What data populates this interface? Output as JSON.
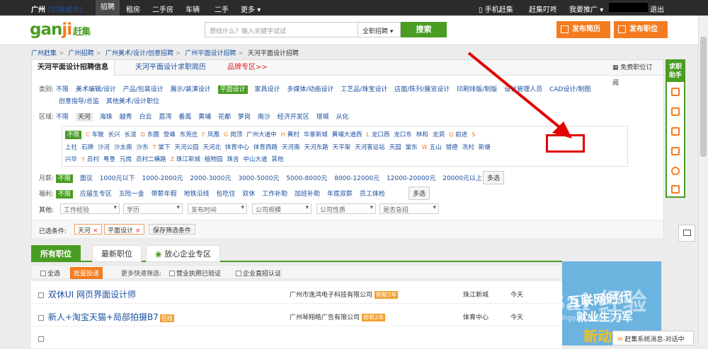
{
  "topbar": {
    "city": "广州",
    "switch_city": "[切换城市]",
    "nav": [
      "招聘",
      "租房",
      "二手房",
      "车辆",
      "二手",
      "更多"
    ],
    "mobile": "手机赶集",
    "chat": "赶集叮咚",
    "promote": "我要推广",
    "logout": "退出"
  },
  "header": {
    "logo_main": "gan",
    "logo_o": "ji",
    "logo_zj": "赶集",
    "search_placeholder": "想找什么？输入关键字试试",
    "search_scope": "全职招聘",
    "search_button": "搜索",
    "post_resume": "发布简历",
    "post_job": "发布职位"
  },
  "breadcrumb": [
    "广州赶集",
    "广州招聘",
    "广州美术/设计/创意招聘",
    "广州平面设计招聘",
    "天河平面设计招聘"
  ],
  "panel": {
    "tabs": [
      "天河平面设计招聘信息",
      "天河平面设计求职简历",
      "品牌专区>>"
    ],
    "subscribe": "免费职位订阅",
    "category_label": "类别:",
    "categories_row1": [
      "不限",
      "美术编辑/设计",
      "产品/包装设计",
      "展示/装潢设计",
      "平面设计",
      "家具设计",
      "多媒体/动画设计",
      "工艺品/珠宝设计",
      "店面/陈列/展览设计",
      "印刷排版/制版",
      "设计管理人员",
      "CAD设计/制图"
    ],
    "categories_row2": [
      "创意指导/总监",
      "其他美术/设计职位"
    ],
    "region_label": "区域:",
    "regions": [
      "不限",
      "天河",
      "海珠",
      "越秀",
      "白云",
      "荔湾",
      "番禺",
      "黄埔",
      "花都",
      "萝岗",
      "南沙",
      "经济开发区",
      "增城",
      "从化"
    ],
    "salary_label": "月薪:",
    "salaries": [
      "不限",
      "面议",
      "1000元以下",
      "1000-2000元",
      "2000-3000元",
      "3000-5000元",
      "5000-8000元",
      "8000-12000元",
      "12000-20000元",
      "20000元以上"
    ],
    "multi": "多选",
    "welfare_label": "福利:",
    "welfare": [
      "不限",
      "应届生专区",
      "五险一金",
      "带薪年假",
      "地铁沿线",
      "包吃住",
      "双休",
      "工作补助",
      "加班补助",
      "年底双薪",
      "员工体检"
    ],
    "other_label": "其他:",
    "dropdowns": [
      "工作经验",
      "学历",
      "发布时间",
      "公司规模",
      "公司性质",
      "是否急招"
    ],
    "selected_label": "已选条件:",
    "selected": [
      "天河",
      "平面设计"
    ],
    "save_filter": "保存筛选条件"
  },
  "districts": {
    "row1": [
      {
        "letter": "",
        "name": "不限"
      },
      {
        "letter": "C",
        "name": "车陂"
      },
      {
        "letter": "",
        "name": "长兴"
      },
      {
        "letter": "",
        "name": "长湴"
      },
      {
        "letter": "D",
        "name": "东圃"
      },
      {
        "letter": "",
        "name": "登峰"
      },
      {
        "letter": "",
        "name": "东莞庄"
      },
      {
        "letter": "F",
        "name": "凤凰"
      },
      {
        "letter": "G",
        "name": "岗顶"
      },
      {
        "letter": "",
        "name": "广州大道中"
      },
      {
        "letter": "H",
        "name": "黄村"
      },
      {
        "letter": "",
        "name": "华景新城"
      },
      {
        "letter": "",
        "name": "黄埔大道西"
      },
      {
        "letter": "L",
        "name": "龙口西"
      },
      {
        "letter": "",
        "name": "龙口东"
      },
      {
        "letter": "",
        "name": "林和"
      },
      {
        "letter": "",
        "name": "龙洞"
      },
      {
        "letter": "Q",
        "name": "前进"
      },
      {
        "letter": "S",
        "name": ""
      }
    ],
    "row2": [
      {
        "letter": "",
        "name": "上社"
      },
      {
        "letter": "",
        "name": "石牌"
      },
      {
        "letter": "",
        "name": "沙河"
      },
      {
        "letter": "",
        "name": "沙太南"
      },
      {
        "letter": "",
        "name": "沙东"
      },
      {
        "letter": "T",
        "name": "棠下"
      },
      {
        "letter": "",
        "name": "天河公园"
      },
      {
        "letter": "",
        "name": "天河北"
      },
      {
        "letter": "",
        "name": "体育中心"
      },
      {
        "letter": "",
        "name": "体育西路"
      },
      {
        "letter": "",
        "name": "天河南"
      },
      {
        "letter": "",
        "name": "天河东路"
      },
      {
        "letter": "",
        "name": "天平架"
      },
      {
        "letter": "",
        "name": "天河客运站"
      },
      {
        "letter": "",
        "name": "天园"
      },
      {
        "letter": "",
        "name": "棠东"
      },
      {
        "letter": "W",
        "name": "五山"
      },
      {
        "letter": "",
        "name": "猎德"
      },
      {
        "letter": "",
        "name": "冼村"
      },
      {
        "letter": "",
        "name": "新塘"
      }
    ],
    "row3": [
      {
        "letter": "",
        "name": "兴华"
      },
      {
        "letter": "Y",
        "name": "员村"
      },
      {
        "letter": "",
        "name": "粤垦"
      },
      {
        "letter": "",
        "name": "元岗"
      },
      {
        "letter": "",
        "name": "员村二横路"
      },
      {
        "letter": "Z",
        "name": "珠江新城"
      },
      {
        "letter": "",
        "name": "植物园"
      },
      {
        "letter": "",
        "name": "珠吉"
      },
      {
        "letter": "",
        "name": "中山大道"
      },
      {
        "letter": "",
        "name": "其他"
      }
    ]
  },
  "jobs": {
    "tabs": [
      "所有职位",
      "最新职位",
      "放心企业专区"
    ],
    "select_all": "全选",
    "batch_apply": "批量投递",
    "quick_filter": "更多快速筛选:",
    "license": "营业执照已验证",
    "company_verified": "企业直招认证",
    "rows": [
      {
        "title": "双休UI 网页界面设计师",
        "hot": "",
        "company": "广州市逸鸿电子科技有限公司",
        "badge": "帮帮2年",
        "area": "珠江新城",
        "date": "今天"
      },
      {
        "title": "新人+淘宝天猫+局部拍摄B7",
        "hot": "在线",
        "company": "广州琴翔皓广告有限公司",
        "badge": "帮帮2年",
        "area": "体育中心",
        "date": "今天"
      },
      {
        "title": "",
        "hot": "",
        "company": "",
        "badge": "",
        "area": "",
        "date": ""
      }
    ]
  },
  "sidebar": {
    "title": "求职助手"
  },
  "ad": {
    "t1": "互联网时代",
    "t2": "就业生力军",
    "t3": "新动"
  },
  "chat_bar": "赶集系统消息-对话中",
  "watermark": {
    "main": "Bai 经验",
    "sub": "jingyan.baidu.com"
  },
  "colors": {
    "brand_green": "#4a9d23",
    "brand_orange": "#f47c20",
    "highlight_red": "#e00000"
  }
}
